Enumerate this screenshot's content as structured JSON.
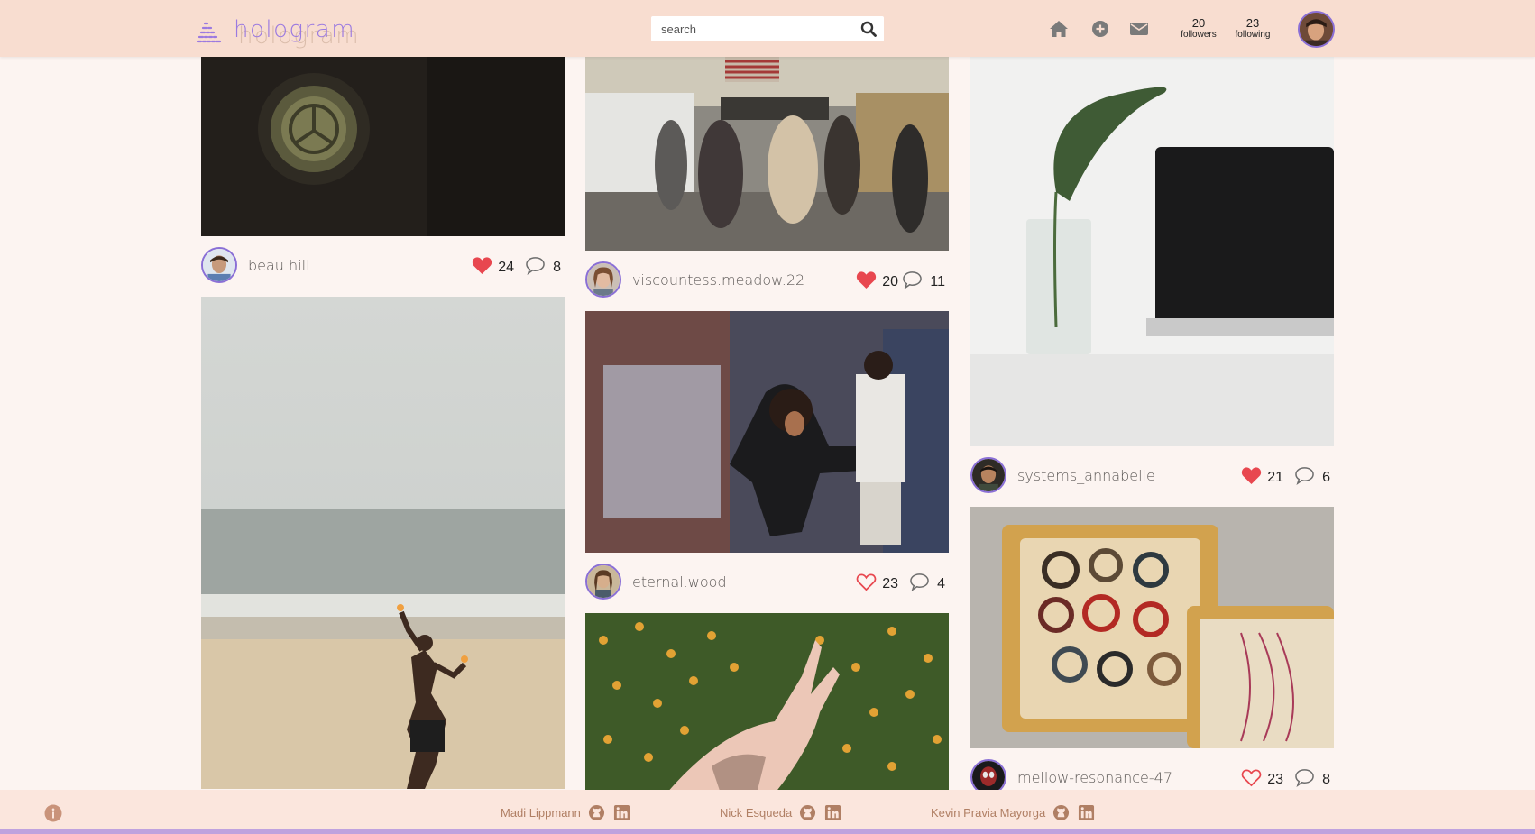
{
  "app": {
    "name": "hologram"
  },
  "search": {
    "placeholder": "search",
    "value": ""
  },
  "nav": {
    "icons": [
      "home-icon",
      "add-post-icon",
      "messages-icon"
    ],
    "followers": {
      "count": "20",
      "label": "followers"
    },
    "following": {
      "count": "23",
      "label": "following"
    }
  },
  "colors": {
    "header": "#f8ddd0",
    "background": "#fcf4f1",
    "accent": "#8a6fd6",
    "heart": "#e8474f",
    "footer": "#fbe6dd"
  },
  "posts": {
    "col1": [
      {
        "username": "beau.hill",
        "likes": "24",
        "comments": "8",
        "liked": true,
        "image": "mercedes hubcap in dark"
      },
      {
        "username": "",
        "likes": "",
        "comments": "",
        "liked": false,
        "image": "fire dancer on beach"
      }
    ],
    "col2": [
      {
        "username": "viscountess.meadow.22",
        "likes": "20",
        "comments": "11",
        "liked": true,
        "image": "crowded train station hall"
      },
      {
        "username": "eternal.wood",
        "likes": "23",
        "comments": "4",
        "liked": false,
        "image": "dancers in motion blur"
      },
      {
        "username": "",
        "likes": "",
        "comments": "",
        "liked": false,
        "image": "tattooed hands over yellow flowers"
      }
    ],
    "col3": [
      {
        "username": "systems_annabelle",
        "likes": "21",
        "comments": "6",
        "liked": true,
        "image": "leaf in glass beside laptop"
      },
      {
        "username": "mellow-resonance-47",
        "likes": "23",
        "comments": "8",
        "liked": false,
        "image": "bracelets in wooden trays"
      }
    ]
  },
  "footer": {
    "credits": [
      {
        "name": "Madi Lippmann"
      },
      {
        "name": "Nick Esqueda"
      },
      {
        "name": "Kevin Pravia Mayorga"
      }
    ]
  }
}
